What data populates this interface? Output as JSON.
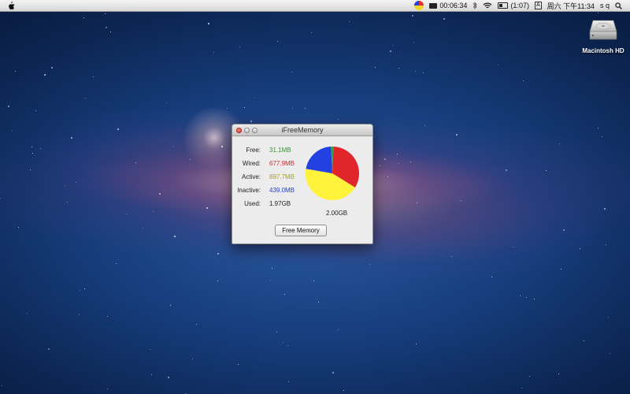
{
  "menubar": {
    "clock_timer": "00:06:34",
    "battery_time": "(1:07)",
    "input_method": "A",
    "datetime": "周六 下午11:34",
    "user": "s q"
  },
  "desktop": {
    "disk_label": "Macintosh HD"
  },
  "window": {
    "title": "iFreeMemory",
    "stats": [
      {
        "label": "Free:",
        "value": "31.1MB",
        "color": "#2d9a2d"
      },
      {
        "label": "Wired:",
        "value": "677.9MB",
        "color": "#d8262a"
      },
      {
        "label": "Active:",
        "value": "897.7MB",
        "color": "#a8a022"
      },
      {
        "label": "Inactive:",
        "value": "439.0MB",
        "color": "#2240d8"
      },
      {
        "label": "Used:",
        "value": "1.97GB",
        "color": "#222222"
      }
    ],
    "total": "2.00GB",
    "button_label": "Free Memory"
  },
  "chart_data": {
    "type": "pie",
    "categories": [
      "Free",
      "Wired",
      "Active",
      "Inactive"
    ],
    "values": [
      31.1,
      677.9,
      897.7,
      439.0
    ],
    "colors": [
      "#2fa83a",
      "#e0262a",
      "#fff23a",
      "#2340e0"
    ]
  }
}
